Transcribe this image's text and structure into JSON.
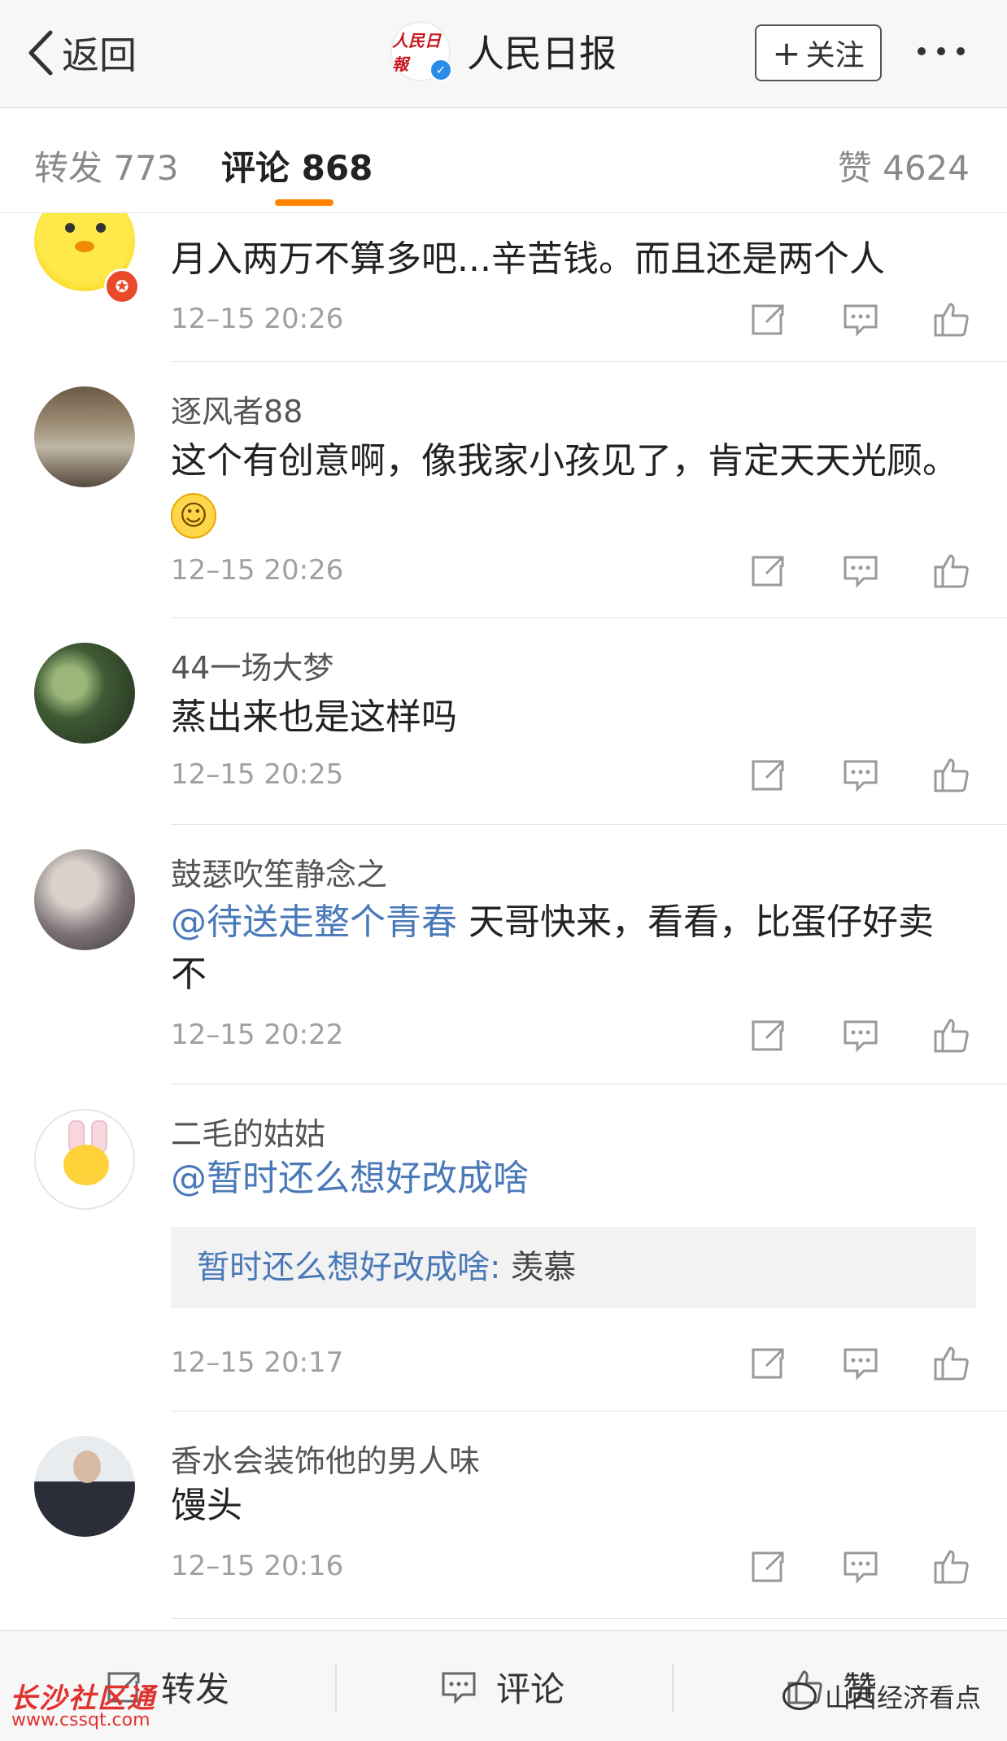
{
  "nav": {
    "back_label": "返回",
    "account_name": "人民日报",
    "logo_mark": "人民日報",
    "follow_label": "关注"
  },
  "tabs": {
    "repost": "转发 773",
    "comment": "评论 868",
    "like": "赞 4624"
  },
  "comments": [
    {
      "name": "",
      "text": "月入两万不算多吧...辛苦钱。而且还是两个人",
      "time": "12–15 20:26"
    },
    {
      "name": "逐风者88",
      "text": "这个有创意啊，像我家小孩见了，肯定天天光顾。",
      "time": "12–15 20:26"
    },
    {
      "name": "44一场大梦",
      "text": "蒸出来也是这样吗",
      "time": "12–15 20:25"
    },
    {
      "name": "鼓瑟吹笙静念之",
      "mention": "@待送走整个青春",
      "text": " 天哥快来，看看，比蛋仔好卖不",
      "time": "12–15 20:22"
    },
    {
      "name": "二毛的姑姑",
      "mention": "@暂时还么想好改成啥",
      "quote_user": "暂时还么想好改成啥:",
      "quote_text": " 羡慕",
      "time": "12–15 20:17"
    },
    {
      "name": "香水会装饰他的男人味",
      "text": "馒头",
      "time": "12–15 20:16"
    }
  ],
  "bottom": {
    "repost": "转发",
    "comment": "评论",
    "like": "赞"
  },
  "watermark": {
    "left_title": "长沙社区通",
    "left_url": "www.cssqt.com",
    "right": "山西经济看点"
  }
}
